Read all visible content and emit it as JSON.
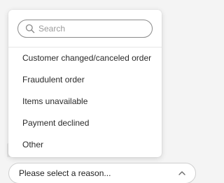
{
  "search": {
    "placeholder": "Search",
    "value": ""
  },
  "options": [
    {
      "label": "Customer changed/canceled order"
    },
    {
      "label": "Fraudulent order"
    },
    {
      "label": "Items unavailable"
    },
    {
      "label": "Payment declined"
    },
    {
      "label": "Other"
    }
  ],
  "select": {
    "value": "Please select a reason..."
  },
  "icons": {
    "search": "search-icon",
    "chevron": "chevron-up-icon"
  },
  "colors": {
    "background": "#f4f4f4",
    "surface": "#ffffff",
    "border": "#8a8a8a",
    "text": "#1f1f1f",
    "placeholder": "#9a9a9a"
  }
}
